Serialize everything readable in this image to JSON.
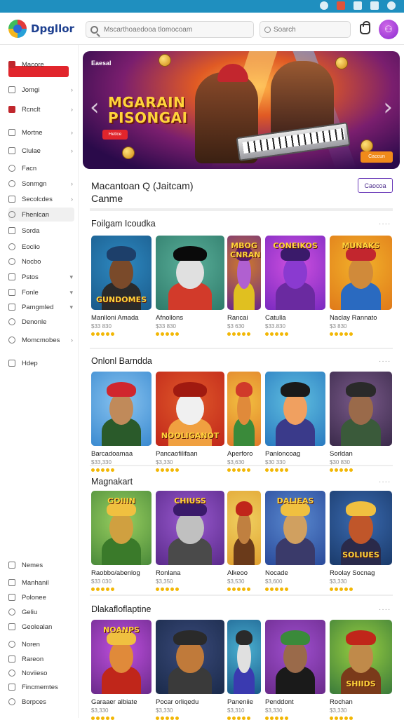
{
  "header": {
    "logo_text": "Dpgllor",
    "search_placeholder": "Mscarthoaedooa tlomocoam",
    "search2_placeholder": "Soarch",
    "avatar_glyph": "⚇"
  },
  "sidebar": {
    "items": [
      {
        "label": "Macore",
        "icon": "home-icon",
        "chevron": ""
      },
      {
        "label": "Jomgi",
        "icon": "page-icon",
        "chevron": "›"
      },
      {
        "label": "Rcnclt",
        "icon": "gift-icon",
        "chevron": "›"
      },
      {
        "label": "Mortne",
        "icon": "home-icon",
        "chevron": "›"
      },
      {
        "label": "Clulae",
        "icon": "grid-icon",
        "chevron": "›"
      },
      {
        "label": "Facn",
        "icon": "circle-icon",
        "chevron": ""
      },
      {
        "label": "Sonmgn",
        "icon": "lock-icon",
        "chevron": "›"
      },
      {
        "label": "Secolcdes",
        "icon": "box-icon",
        "chevron": "›"
      },
      {
        "label": "Fhenlcan",
        "icon": "gear-icon",
        "chevron": ""
      },
      {
        "label": "Sorda",
        "icon": "tag-icon",
        "chevron": ""
      },
      {
        "label": "Eoclio",
        "icon": "clock-icon",
        "chevron": ""
      },
      {
        "label": "Nocbo",
        "icon": "circle-icon",
        "chevron": ""
      },
      {
        "label": "Pstos",
        "icon": "tag-icon",
        "chevron": "▾"
      },
      {
        "label": "Fonle",
        "icon": "grid-icon",
        "chevron": "▾"
      },
      {
        "label": "Pamgmled",
        "icon": "page-icon",
        "chevron": "▾"
      },
      {
        "label": "Denonle",
        "icon": "circle-icon",
        "chevron": ""
      },
      {
        "label": "Momcmobes",
        "icon": "gear-icon",
        "chevron": "›"
      },
      {
        "label": "Hdep",
        "icon": "grid-icon",
        "chevron": ""
      },
      {
        "label": "Nemes",
        "icon": "grid-icon",
        "chevron": ""
      },
      {
        "label": "Manhanil",
        "icon": "tag-icon",
        "chevron": ""
      },
      {
        "label": "Polonee",
        "icon": "page-icon",
        "chevron": ""
      },
      {
        "label": "Geliu",
        "icon": "lock-icon",
        "chevron": ""
      },
      {
        "label": "Geolealan",
        "icon": "box-icon",
        "chevron": ""
      },
      {
        "label": "Noren",
        "icon": "circle-icon",
        "chevron": ""
      },
      {
        "label": "Rareon",
        "icon": "page-icon",
        "chevron": ""
      },
      {
        "label": "Noviieso",
        "icon": "circle-icon",
        "chevron": ""
      },
      {
        "label": "Fincmemtes",
        "icon": "box-icon",
        "chevron": ""
      },
      {
        "label": "Borpces",
        "icon": "circle-icon",
        "chevron": ""
      }
    ]
  },
  "hero": {
    "small_label": "Eaesal",
    "title_line1": "MGARAIN",
    "title_line2": "PISONGAI",
    "button_label": "Hetlce",
    "button2_label": "Caccun",
    "prev_glyph": "‹",
    "next_glyph": "›"
  },
  "section": {
    "title_line1": "Macantoan Q (Jaitcam)",
    "title_line2": "Canme",
    "button_label": "Caocoa"
  },
  "rows": [
    {
      "title": "Foilgam Icoudka",
      "more": "····",
      "games": [
        {
          "name": "Manlloni Amada",
          "sub": "$33 830",
          "art": "GUNDOMES",
          "art_pos": "bottom"
        },
        {
          "name": "Afnollons",
          "sub": "$33 830",
          "art": "",
          "art_pos": "none"
        },
        {
          "name": "Rancai",
          "sub": "$3 630",
          "art": "MBOG CNRAN",
          "art_pos": "top"
        },
        {
          "name": "Catulla",
          "sub": "$33.830",
          "art": "CONEIKOS",
          "art_pos": "top"
        },
        {
          "name": "Naclay Rannato",
          "sub": "$3 830",
          "art": "MUNAKS",
          "art_pos": "top"
        }
      ]
    },
    {
      "title": "Onlonl Barndda",
      "more": "····",
      "games": [
        {
          "name": "Barcadoamaa",
          "sub": "$33,330",
          "art": "",
          "art_pos": "none"
        },
        {
          "name": "Pancaofilifaan",
          "sub": "$3,330",
          "art": "NOOLIGANOT",
          "art_pos": "bottom"
        },
        {
          "name": "Aperforo",
          "sub": "$3,630",
          "art": "",
          "art_pos": "none"
        },
        {
          "name": "Panloncoag",
          "sub": "$30 330",
          "art": "",
          "art_pos": "none"
        },
        {
          "name": "Sorldan",
          "sub": "$30 830",
          "art": "",
          "art_pos": "none"
        }
      ]
    },
    {
      "title": "Magnakart",
      "more": "····",
      "games": [
        {
          "name": "Raobbo/abenlog",
          "sub": "$33 030",
          "art": "GOIIIN",
          "art_pos": "top"
        },
        {
          "name": "Ronlana",
          "sub": "$3,350",
          "art": "CHIUSS",
          "art_pos": "top"
        },
        {
          "name": "Alkeoo",
          "sub": "$3,530",
          "art": "",
          "art_pos": "none"
        },
        {
          "name": "Nocade",
          "sub": "$3,600",
          "art": "DALIEAS",
          "art_pos": "top"
        },
        {
          "name": "Roolay Socnag",
          "sub": "$3,330",
          "art": "SOLIUES",
          "art_pos": "bottom"
        }
      ]
    },
    {
      "title": "Dlakafloflaptine",
      "more": "····",
      "games": [
        {
          "name": "Garaaer albiate",
          "sub": "$3,330",
          "art": "NOANPS",
          "art_pos": "top"
        },
        {
          "name": "Pocar orliqedu",
          "sub": "$3,330",
          "art": "",
          "art_pos": "none"
        },
        {
          "name": "Paneniie",
          "sub": "$3,310",
          "art": "",
          "art_pos": "none"
        },
        {
          "name": "Penddont",
          "sub": "$3,330",
          "art": "",
          "art_pos": "none"
        },
        {
          "name": "Rochan",
          "sub": "$3,330",
          "art": "SHIIDS",
          "art_pos": "bottom"
        }
      ]
    }
  ],
  "colors": {
    "statusbar": "#1f8fbf",
    "accent_purple": "#8b2ad0",
    "accent_red": "#e1252c",
    "star": "#f2b705"
  }
}
